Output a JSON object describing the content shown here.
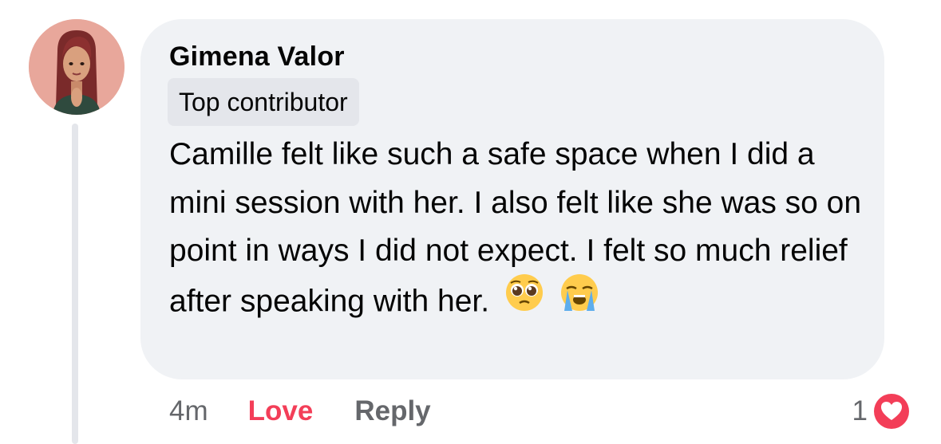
{
  "comment": {
    "author": "Gimena Valor",
    "badge": "Top contributor",
    "text": "Camille felt like such a safe space when I did a mini session with her. I also felt like she was so on point in ways I did not expect. I felt so much relief after speaking with her.",
    "emojis": [
      "pleading-face-icon",
      "loudly-crying-face-icon"
    ]
  },
  "actions": {
    "time": "4m",
    "love_label": "Love",
    "reply_label": "Reply"
  },
  "reactions": {
    "count": "1",
    "type": "love-heart-icon",
    "color": "#f33e58"
  },
  "colors": {
    "bubble": "#f0f2f5",
    "badge": "#e4e6eb",
    "love": "#f33e58",
    "secondary_text": "#65676b"
  }
}
